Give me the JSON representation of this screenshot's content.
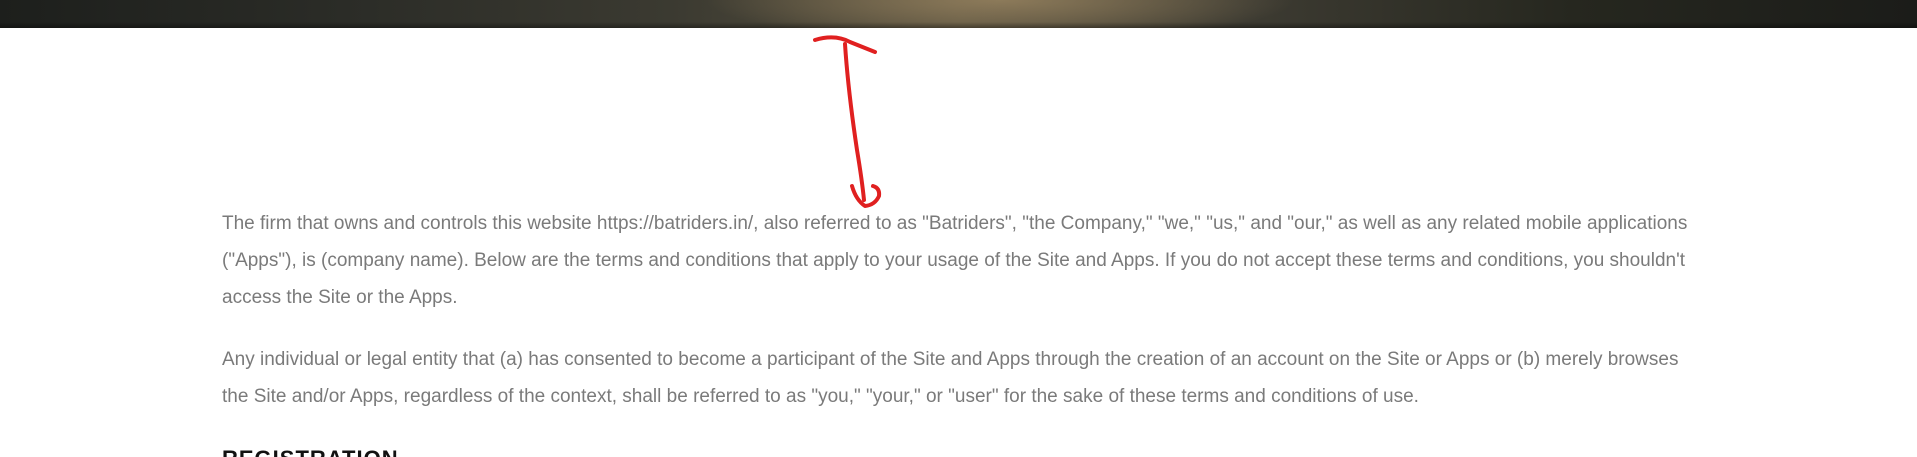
{
  "terms": {
    "paragraph_1": "The firm that owns and controls this website https://batriders.in/, also referred to as \"Batriders\", \"the Company,\" \"we,\" \"us,\" and \"our,\" as well as any related mobile applications (\"Apps\"), is (company name). Below are the terms and conditions that apply to your usage of the Site and Apps. If you do not accept these terms and conditions, you shouldn't access the Site or the Apps.",
    "paragraph_2": "Any individual or legal entity that (a) has consented to become a participant of the Site and Apps through the creation of an account on the Site or Apps or (b) merely browses the Site and/or Apps, regardless of the context, shall be referred to as \"you,\" \"your,\" or \"user\" for the sake of these terms and conditions of use.",
    "next_heading": "REGISTRATION"
  },
  "annotation": {
    "icon": "hand-drawn-arrow-icon",
    "color": "#e02020"
  }
}
